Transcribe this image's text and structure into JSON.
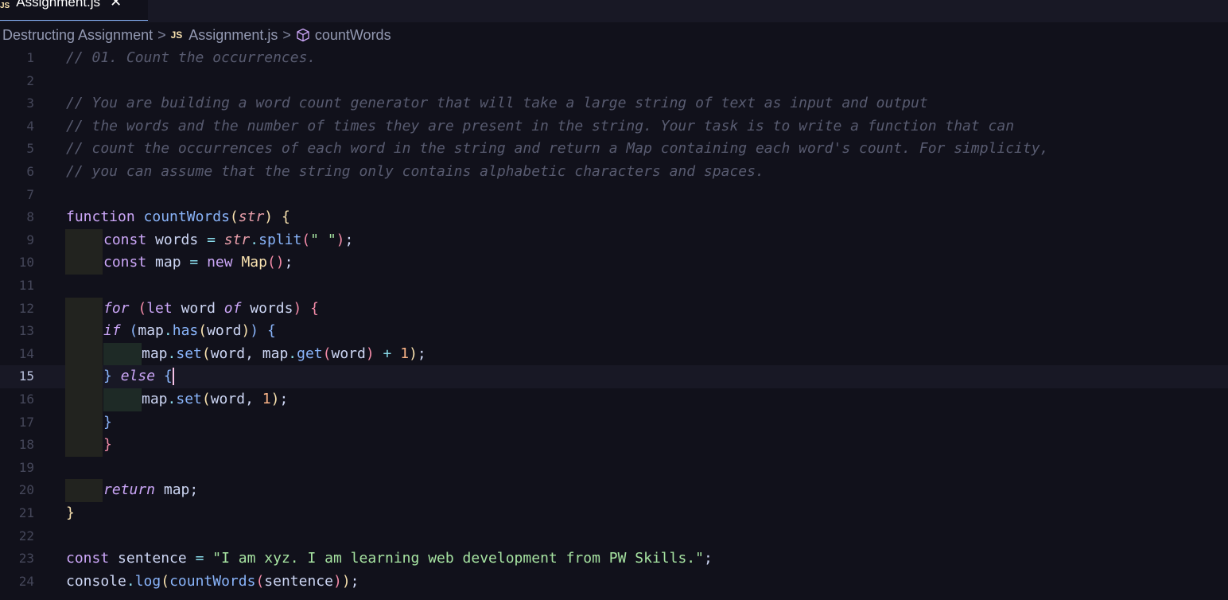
{
  "tab": {
    "icon": "JS",
    "title": "Assignment.js",
    "close": "✕"
  },
  "breadcrumb": {
    "folder": "Destructing Assignment",
    "file_icon": "JS",
    "file": "Assignment.js",
    "symbol_icon": "cube-icon",
    "symbol": "countWords",
    "separator": ">"
  },
  "editor": {
    "active_line": 15,
    "line_numbers": [
      "1",
      "2",
      "3",
      "4",
      "5",
      "6",
      "7",
      "8",
      "9",
      "10",
      "11",
      "12",
      "13",
      "14",
      "15",
      "16",
      "17",
      "18",
      "19",
      "20",
      "21",
      "22",
      "23",
      "24"
    ],
    "lines": {
      "l1": "// 01. Count the occurrences.",
      "l3": "// You are building a word count generator that will take a large string of text as input and output",
      "l4": "// the words and the number of times they are present in the string. Your task is to write a function that can",
      "l5": "// count the occurrences of each word in the string and return a Map containing each word's count. For simplicity,",
      "l6": "// you can assume that the string only contains alphabetic characters and spaces.",
      "kw_function": "function",
      "fn_countWords": "countWords",
      "param_str": "str",
      "kw_const": "const",
      "id_words": "words",
      "id_map": "map",
      "m_split": "split",
      "str_space": "\" \"",
      "kw_new": "new",
      "cls_Map": "Map",
      "kw_for": "for",
      "kw_let": "let",
      "id_word": "word",
      "kw_of": "of",
      "kw_if": "if",
      "m_has": "has",
      "m_set": "set",
      "m_get": "get",
      "num_1": "1",
      "kw_else": "else",
      "kw_return": "return",
      "id_sentence": "sentence",
      "str_sentence": "\"I am xyz. I am learning web development from PW Skills.\"",
      "id_console": "console",
      "m_log": "log"
    }
  }
}
